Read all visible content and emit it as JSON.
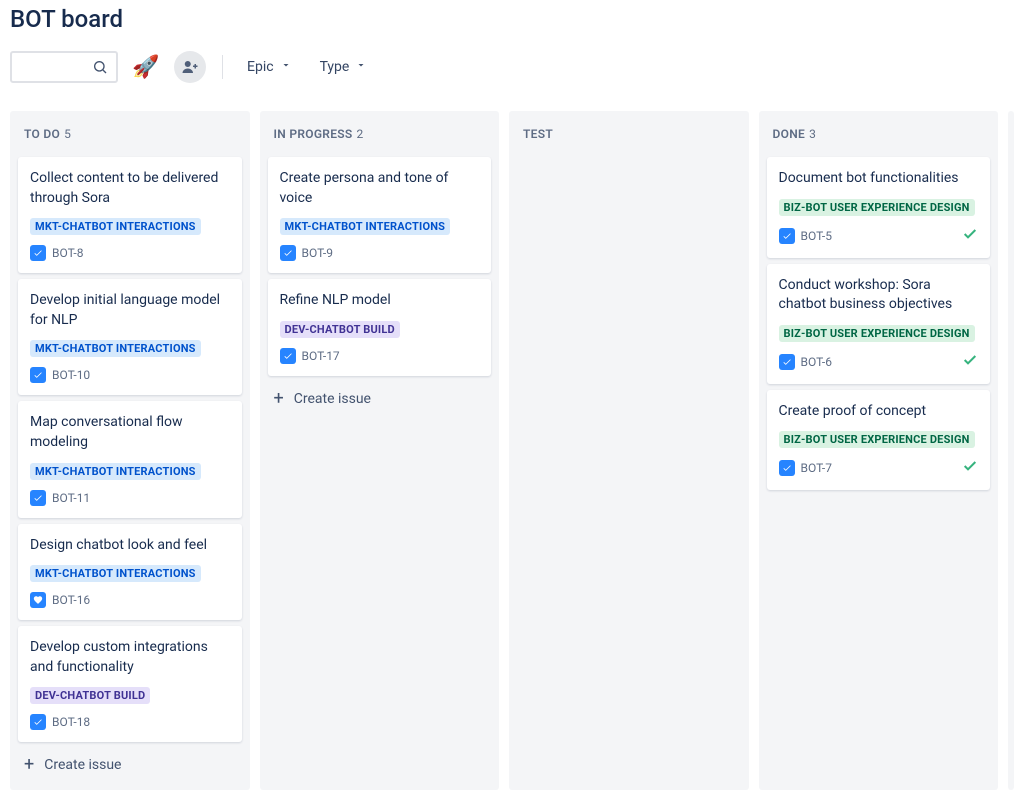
{
  "header": {
    "title": "BOT board"
  },
  "toolbar": {
    "search_placeholder": "",
    "rocket_icon": "🚀",
    "epic_label": "Epic",
    "type_label": "Type"
  },
  "create_issue_label": "Create issue",
  "tags": {
    "mkt": {
      "label": "MKT-CHATBOT INTERACTIONS",
      "class": "tag-blue"
    },
    "biz": {
      "label": "BIZ-BOT USER EXPERIENCE DESIGN",
      "class": "tag-green"
    },
    "dev": {
      "label": "DEV-CHATBOT BUILD",
      "class": "tag-purple"
    }
  },
  "columns": [
    {
      "id": "todo",
      "title": "TO DO",
      "count": "5",
      "show_create": true,
      "cards": [
        {
          "title": "Collect content to be delivered through Sora",
          "tag": "mkt",
          "issue_id": "BOT-8",
          "icon": "task",
          "done": false
        },
        {
          "title": "Develop initial language model for NLP",
          "tag": "mkt",
          "issue_id": "BOT-10",
          "icon": "task",
          "done": false
        },
        {
          "title": "Map conversational flow modeling",
          "tag": "mkt",
          "issue_id": "BOT-11",
          "icon": "task",
          "done": false
        },
        {
          "title": "Design chatbot look and feel",
          "tag": "mkt",
          "issue_id": "BOT-16",
          "icon": "design",
          "done": false
        },
        {
          "title": "Develop custom integrations and functionality",
          "tag": "dev",
          "issue_id": "BOT-18",
          "icon": "task",
          "done": false
        }
      ]
    },
    {
      "id": "inprogress",
      "title": "IN PROGRESS",
      "count": "2",
      "show_create": true,
      "cards": [
        {
          "title": "Create persona and tone of voice",
          "tag": "mkt",
          "issue_id": "BOT-9",
          "icon": "task",
          "done": false
        },
        {
          "title": "Refine NLP model",
          "tag": "dev",
          "issue_id": "BOT-17",
          "icon": "task",
          "done": false
        }
      ]
    },
    {
      "id": "test",
      "title": "TEST",
      "count": "",
      "show_create": false,
      "cards": []
    },
    {
      "id": "done",
      "title": "DONE",
      "count": "3",
      "show_create": false,
      "cards": [
        {
          "title": "Document bot functionalities",
          "tag": "biz",
          "issue_id": "BOT-5",
          "icon": "task",
          "done": true
        },
        {
          "title": "Conduct workshop: Sora chatbot business objectives",
          "tag": "biz",
          "issue_id": "BOT-6",
          "icon": "task",
          "done": true
        },
        {
          "title": "Create proof of concept",
          "tag": "biz",
          "issue_id": "BOT-7",
          "icon": "task",
          "done": true
        }
      ]
    }
  ]
}
